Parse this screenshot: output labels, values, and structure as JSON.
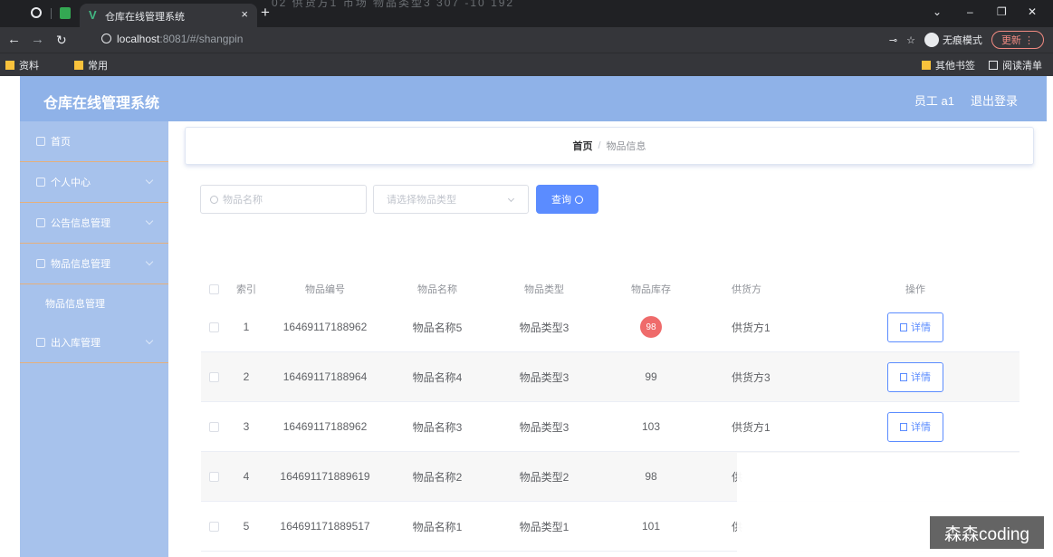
{
  "browser": {
    "ghost_text": "02    供货方1         市场        物品类型3     307    -10 192",
    "tab_title": "仓库在线管理系统",
    "tab_favicon": "V",
    "new_tab": "+",
    "close_tab": "×",
    "window_controls": [
      "⌄",
      "–",
      "❐",
      "✕"
    ],
    "url_host": "localhost",
    "url_rest": ":8081/#/shangpin",
    "incognito_label": "无痕模式",
    "update_label": "更新",
    "bookmarks": [
      "资料",
      "常用"
    ],
    "other_bookmarks": "其他书签",
    "reading_list": "阅读清单"
  },
  "header": {
    "title": "仓库在线管理系统",
    "user": "员工 a1",
    "logout": "退出登录"
  },
  "sidebar": {
    "items": [
      {
        "label": "首页"
      },
      {
        "label": "个人中心"
      },
      {
        "label": "公告信息管理"
      },
      {
        "label": "物品信息管理"
      },
      {
        "label": "物品信息管理"
      },
      {
        "label": "出入库管理"
      }
    ]
  },
  "breadcrumb": {
    "home": "首页",
    "sep": "/",
    "current": "物品信息"
  },
  "search": {
    "name_placeholder": "物品名称",
    "type_placeholder": "请选择物品类型",
    "query_label": "查询"
  },
  "table": {
    "headers": [
      "索引",
      "物品编号",
      "物品名称",
      "物品类型",
      "物品库存",
      "供货方",
      "操作"
    ],
    "detail_label": "详情",
    "rows": [
      {
        "idx": "1",
        "no": "16469117188962",
        "name": "物品名称5",
        "type": "物品类型3",
        "stock": "98",
        "supplier": "供货方1"
      },
      {
        "idx": "2",
        "no": "16469117188964",
        "name": "物品名称4",
        "type": "物品类型3",
        "stock": "99",
        "supplier": "供货方3"
      },
      {
        "idx": "3",
        "no": "16469117188962",
        "name": "物品名称3",
        "type": "物品类型3",
        "stock": "103",
        "supplier": "供货方1"
      },
      {
        "idx": "4",
        "no": "164691171889619",
        "name": "物品名称2",
        "type": "物品类型2",
        "stock": "98",
        "supplier": "供"
      },
      {
        "idx": "5",
        "no": "164691171889517",
        "name": "物品名称1",
        "type": "物品类型1",
        "stock": "101",
        "supplier": "供"
      }
    ]
  },
  "watermark": "森森coding"
}
